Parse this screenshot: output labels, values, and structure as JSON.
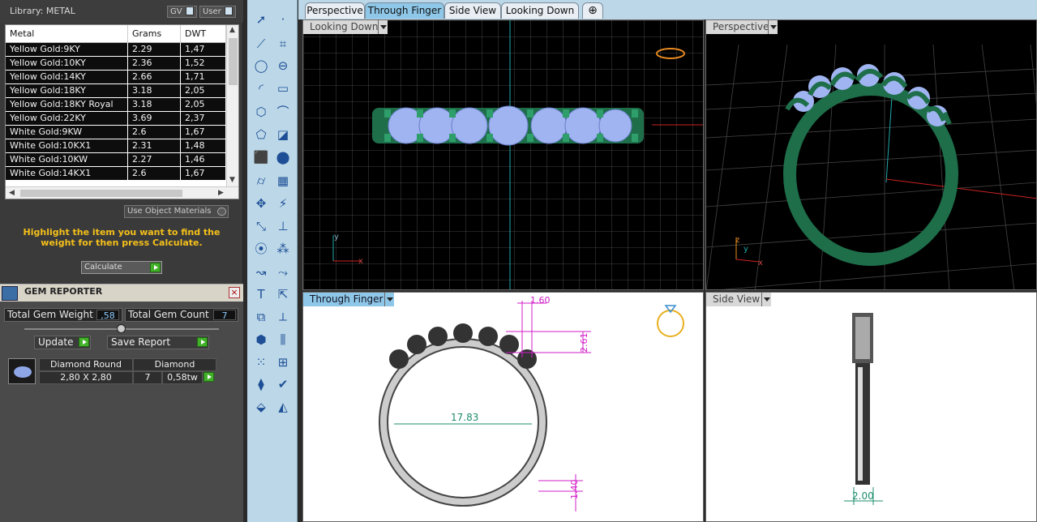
{
  "library": {
    "title": "Library: METAL",
    "gv_label": "GV",
    "user_label": "User"
  },
  "metal_table": {
    "headers": [
      "Metal",
      "Grams",
      "DWT"
    ],
    "rows": [
      [
        "Yellow Gold:9KY",
        "2.29",
        "1,47"
      ],
      [
        "Yellow Gold:10KY",
        "2.36",
        "1,52"
      ],
      [
        "Yellow Gold:14KY",
        "2.66",
        "1,71"
      ],
      [
        "Yellow Gold:18KY",
        "3.18",
        "2,05"
      ],
      [
        "Yellow Gold:18KY Royal",
        "3.18",
        "2,05"
      ],
      [
        "Yellow Gold:22KY",
        "3.69",
        "2,37"
      ],
      [
        "White Gold:9KW",
        "2.6",
        "1,67"
      ],
      [
        "White Gold:10KX1",
        "2.31",
        "1,48"
      ],
      [
        "White Gold:10KW",
        "2.27",
        "1,46"
      ],
      [
        "White Gold:14KX1",
        "2.6",
        "1,67"
      ]
    ]
  },
  "use_object_materials": "Use Object Materials",
  "hint": "Highlight the item you want to find the weight for then press Calculate.",
  "calculate_label": "Calculate",
  "gem_reporter": {
    "title": "GEM REPORTER",
    "total_weight_label": "Total Gem Weight",
    "total_weight_value": ",58",
    "total_count_label": "Total Gem Count",
    "total_count_value": "7",
    "update_label": "Update",
    "save_label": "Save Report",
    "gem": {
      "shape": "Diamond Round",
      "type": "Diamond",
      "size": "2,80 X 2,80",
      "count": "7",
      "weight": "0,58tw"
    }
  },
  "tabs": [
    "Perspective",
    "Through Finger",
    "Side View",
    "Looking Down"
  ],
  "active_tab": "Through Finger",
  "viewports": {
    "top_left": "Looking Down",
    "top_right": "Perspective",
    "bottom_left": "Through Finger",
    "bottom_right": "Side View"
  },
  "dimensions": {
    "prong": "1.60",
    "height": "2.61",
    "inner_diameter": "17.83",
    "shank": "1.40",
    "width": "2.00"
  },
  "axes": {
    "x": "x",
    "y": "y",
    "z": "z"
  },
  "colors": {
    "ring_green": "#1e6e4a",
    "gem_blue": "#9fb4f0",
    "dim_magenta": "#d21ec8",
    "dim_teal": "#1e8c6e",
    "viewport_bg": "#000000"
  }
}
